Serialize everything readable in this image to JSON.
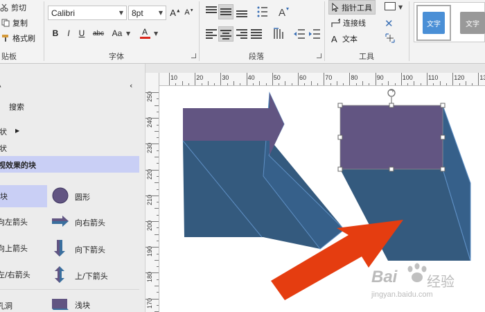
{
  "clipboard": {
    "cut": "剪切",
    "copy": "复制",
    "format_painter": "格式刷",
    "group": "贴板"
  },
  "font": {
    "family": "Calibri",
    "size": "8pt",
    "bold": "B",
    "italic": "I",
    "underline": "U",
    "strike": "abc",
    "case": "Aa",
    "color": "A",
    "group": "字体"
  },
  "paragraph": {
    "group": "段落"
  },
  "tools": {
    "pointer": "指针工具",
    "connector": "连接线",
    "text": "文本",
    "group": "工具"
  },
  "styles": {
    "item1": "文字",
    "item2": "文字"
  },
  "left_panel": {
    "search": "搜索",
    "item_shape": "状",
    "item_shape2": "状",
    "stencil": "视效果的块",
    "shapes": [
      {
        "label": "块"
      },
      {
        "label": "圆形"
      },
      {
        "label": "向左箭头"
      },
      {
        "label": "向右箭头"
      },
      {
        "label": "向上箭头"
      },
      {
        "label": "向下箭头"
      },
      {
        "label": "左/右箭头"
      },
      {
        "label": "上/下箭头"
      },
      {
        "label": "孔洞"
      },
      {
        "label": "浅块"
      }
    ]
  },
  "ruler": {
    "top_ticks": [
      "10",
      "20",
      "30",
      "40",
      "50",
      "60",
      "70",
      "80",
      "90",
      "100",
      "110",
      "120",
      "13"
    ],
    "left_ticks": [
      "250",
      "240",
      "230",
      "220",
      "210",
      "200",
      "190",
      "180",
      "170"
    ]
  },
  "watermark": {
    "brand": "Bai",
    "brand2": "经验",
    "url": "jingyan.baidu.com"
  },
  "colors": {
    "purple": "#625582",
    "blue_face": "#345a7e",
    "orange": "#e53d10",
    "selection": "#c9cff5",
    "font_red": "#d9261c"
  }
}
